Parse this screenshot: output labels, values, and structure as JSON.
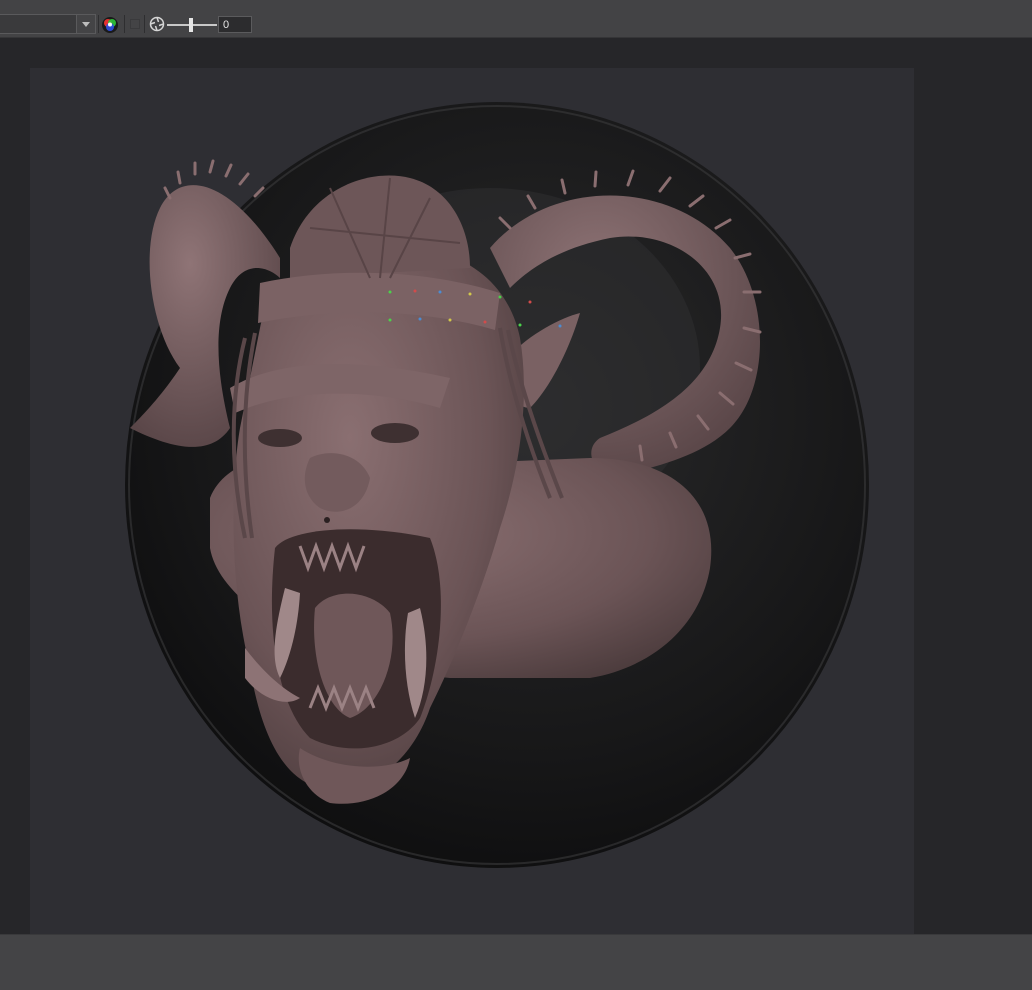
{
  "toolbar": {
    "dropdown_value": "",
    "frame_field_value": "0",
    "icons": [
      "dropdown-arrow-icon",
      "color-wheel-icon",
      "checkbox-icon",
      "aperture-icon",
      "slider-icon"
    ]
  },
  "viewport": {
    "content": "3d-sculpt-render",
    "subject_color": "#6e5658",
    "background_color": "#2e2e33",
    "plaque_color": "#141415"
  },
  "colors": {
    "toolbar_bg": "#434345",
    "bottom_bar_bg": "#444446",
    "outer_bg": "#262629"
  }
}
